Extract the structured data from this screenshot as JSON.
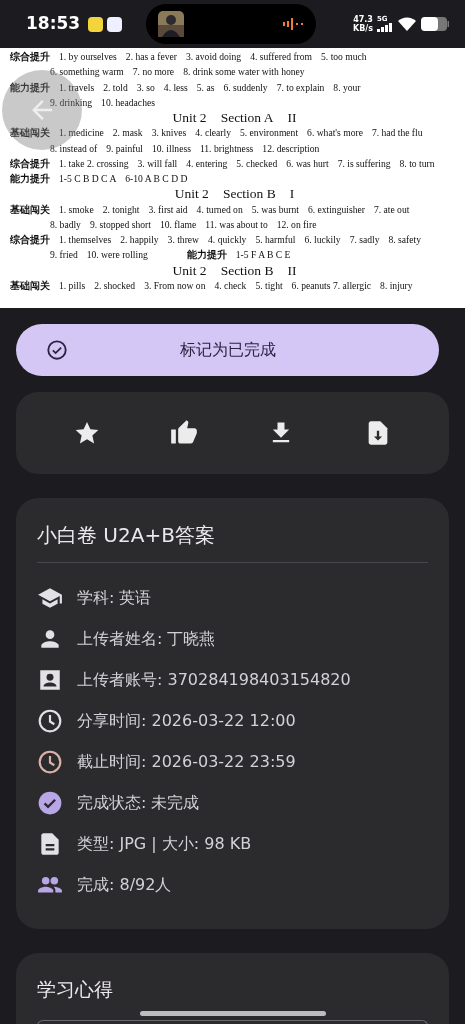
{
  "status_bar": {
    "time": "18:53",
    "speed_value": "47.3",
    "speed_unit": "KB/s",
    "network": "5G"
  },
  "document": {
    "lines": [
      {
        "kind": "row",
        "parts": [
          {
            "kind": "label",
            "text": "综合提升"
          },
          {
            "kind": "answer",
            "text": "1. by ourselves"
          },
          {
            "kind": "answer",
            "text": "2. has a fever"
          },
          {
            "kind": "answer",
            "text": "3. avoid doing"
          },
          {
            "kind": "answer",
            "text": "4. suffered from"
          },
          {
            "kind": "answer",
            "text": "5. too much"
          }
        ]
      },
      {
        "kind": "cont",
        "parts": [
          {
            "kind": "answer",
            "text": "6. something warm"
          },
          {
            "kind": "answer",
            "text": "7. no more"
          },
          {
            "kind": "answer",
            "text": "8. drink some water with honey"
          }
        ]
      },
      {
        "kind": "row",
        "parts": [
          {
            "kind": "label",
            "text": "能力提升"
          },
          {
            "kind": "answer",
            "text": "1. travels"
          },
          {
            "kind": "answer",
            "text": "2. told"
          },
          {
            "kind": "answer",
            "text": "3. so"
          },
          {
            "kind": "answer",
            "text": "4. less"
          },
          {
            "kind": "answer",
            "text": "5. as"
          },
          {
            "kind": "answer",
            "text": "6. suddenly"
          },
          {
            "kind": "answer",
            "text": "7. to explain"
          },
          {
            "kind": "answer",
            "text": "8. your"
          }
        ]
      },
      {
        "kind": "cont",
        "parts": [
          {
            "kind": "answer",
            "text": "9. drinking"
          },
          {
            "kind": "answer",
            "text": "10. headaches"
          }
        ]
      },
      {
        "kind": "heading",
        "parts": [
          {
            "kind": "heading",
            "text": "Unit 2"
          },
          {
            "kind": "heading",
            "text": "Section A"
          },
          {
            "kind": "heading",
            "text": "II"
          }
        ]
      },
      {
        "kind": "row",
        "parts": [
          {
            "kind": "label",
            "text": "基础闯关"
          },
          {
            "kind": "answer",
            "text": "1. medicine"
          },
          {
            "kind": "answer",
            "text": "2. mask"
          },
          {
            "kind": "answer",
            "text": "3. knives"
          },
          {
            "kind": "answer",
            "text": "4. clearly"
          },
          {
            "kind": "answer",
            "text": "5. environment"
          },
          {
            "kind": "answer",
            "text": "6. what's more"
          },
          {
            "kind": "answer",
            "text": "7. had the flu"
          }
        ]
      },
      {
        "kind": "cont",
        "parts": [
          {
            "kind": "answer",
            "text": "8. instead of"
          },
          {
            "kind": "answer",
            "text": "9. painful"
          },
          {
            "kind": "answer",
            "text": "10. illness"
          },
          {
            "kind": "answer",
            "text": "11. brightness"
          },
          {
            "kind": "answer",
            "text": "12. description"
          }
        ]
      },
      {
        "kind": "row",
        "parts": [
          {
            "kind": "label",
            "text": "综合提升"
          },
          {
            "kind": "answer",
            "text": "1. take 2. crossing"
          },
          {
            "kind": "answer",
            "text": "3. will fall"
          },
          {
            "kind": "answer",
            "text": "4. entering"
          },
          {
            "kind": "answer",
            "text": "5. checked"
          },
          {
            "kind": "answer",
            "text": "6. was hurt"
          },
          {
            "kind": "answer",
            "text": "7. is suffering"
          },
          {
            "kind": "answer",
            "text": "8. to turn"
          }
        ]
      },
      {
        "kind": "row",
        "parts": [
          {
            "kind": "label",
            "text": "能力提升"
          },
          {
            "kind": "answer",
            "text": "1-5 C B D C A"
          },
          {
            "kind": "answer",
            "text": "6-10 A B C D D"
          }
        ]
      },
      {
        "kind": "heading",
        "parts": [
          {
            "kind": "heading",
            "text": "Unit 2"
          },
          {
            "kind": "heading",
            "text": "Section B"
          },
          {
            "kind": "heading",
            "text": "I"
          }
        ]
      },
      {
        "kind": "row",
        "parts": [
          {
            "kind": "label",
            "text": "基础闯关"
          },
          {
            "kind": "answer",
            "text": "1. smoke"
          },
          {
            "kind": "answer",
            "text": "2. tonight"
          },
          {
            "kind": "answer",
            "text": "3. first aid"
          },
          {
            "kind": "answer",
            "text": "4. turned on"
          },
          {
            "kind": "answer",
            "text": "5. was burnt"
          },
          {
            "kind": "answer",
            "text": "6. extinguisher"
          },
          {
            "kind": "answer",
            "text": "7. ate out"
          }
        ]
      },
      {
        "kind": "cont",
        "parts": [
          {
            "kind": "answer",
            "text": "8. badly"
          },
          {
            "kind": "answer",
            "text": "9. stopped short"
          },
          {
            "kind": "answer",
            "text": "10. flame"
          },
          {
            "kind": "answer",
            "text": "11. was about to"
          },
          {
            "kind": "answer",
            "text": "12. on fire"
          }
        ]
      },
      {
        "kind": "row",
        "parts": [
          {
            "kind": "label",
            "text": "综合提升"
          },
          {
            "kind": "answer",
            "text": "1. themselves"
          },
          {
            "kind": "answer",
            "text": "2. happily"
          },
          {
            "kind": "answer",
            "text": "3. threw"
          },
          {
            "kind": "answer",
            "text": "4. quickly"
          },
          {
            "kind": "answer",
            "text": "5. harmful"
          },
          {
            "kind": "answer",
            "text": "6. luckily"
          },
          {
            "kind": "answer",
            "text": "7. sadly"
          },
          {
            "kind": "answer",
            "text": "8. safety"
          }
        ]
      },
      {
        "kind": "cont",
        "parts": [
          {
            "kind": "answer",
            "text": "9. fried"
          },
          {
            "kind": "answer",
            "text": "10. were rolling"
          },
          {
            "kind": "label",
            "text": "能力提升"
          },
          {
            "kind": "answer",
            "text": "1-5 F A B C E"
          }
        ]
      },
      {
        "kind": "heading",
        "parts": [
          {
            "kind": "heading",
            "text": "Unit 2"
          },
          {
            "kind": "heading",
            "text": "Section B"
          },
          {
            "kind": "heading",
            "text": "II"
          }
        ]
      },
      {
        "kind": "row",
        "parts": [
          {
            "kind": "label",
            "text": "基础闯关"
          },
          {
            "kind": "answer",
            "text": "1. pills"
          },
          {
            "kind": "answer",
            "text": "2. shocked"
          },
          {
            "kind": "answer",
            "text": "3. From now on"
          },
          {
            "kind": "answer",
            "text": "4. check"
          },
          {
            "kind": "answer",
            "text": "5. tight"
          },
          {
            "kind": "answer",
            "text": "6. peanuts 7. allergic"
          },
          {
            "kind": "answer",
            "text": "8. injury"
          }
        ]
      }
    ]
  },
  "complete_button": {
    "label": "标记为已完成"
  },
  "actions": [
    {
      "kind": "star"
    },
    {
      "kind": "like"
    },
    {
      "kind": "download"
    },
    {
      "kind": "file-download"
    }
  ],
  "info": {
    "title": "小白卷 U2A+B答案",
    "rows": [
      {
        "kind": "subject",
        "text": "学科: 英语",
        "color": "#e2e2e6"
      },
      {
        "kind": "person",
        "text": "上传者姓名: 丁晓燕",
        "color": "#e2e2e6"
      },
      {
        "kind": "account",
        "text": "上传者账号: 370284198403154820",
        "color": "#e2e2e6"
      },
      {
        "kind": "clock",
        "text": "分享时间: 2026-03-22 12:00",
        "color": "#e2e2e6"
      },
      {
        "kind": "clock",
        "text": "截止时间: 2026-03-22 23:59",
        "color": "#d9b3a9"
      },
      {
        "kind": "check",
        "text": "完成状态: 未完成",
        "color": "#b8a6e6"
      },
      {
        "kind": "file",
        "text": "类型: JPG | 大小: 98 KB",
        "color": "#e2e2e6"
      },
      {
        "kind": "group",
        "text": "完成: 8/92人",
        "color": "#b8a6e6"
      }
    ]
  },
  "notes": {
    "title": "学习心得"
  }
}
